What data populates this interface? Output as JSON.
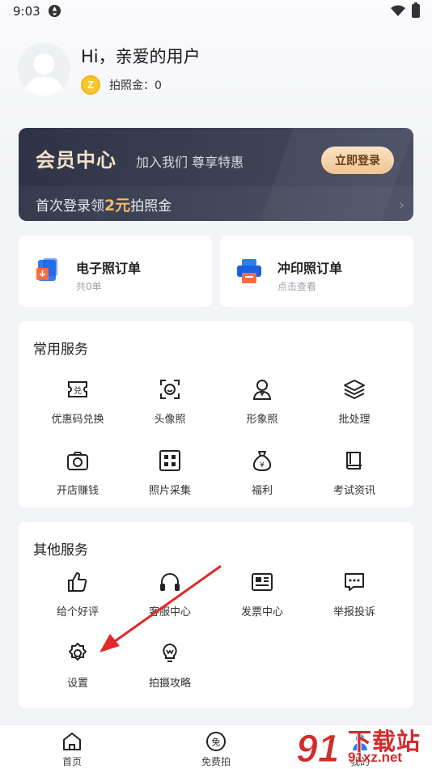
{
  "status_bar": {
    "time": "9:03"
  },
  "profile": {
    "greeting": "Hi，亲爱的用户",
    "coin_label": "拍照金：",
    "coin_value": "0",
    "coin_glyph": "Z"
  },
  "member": {
    "title": "会员中心",
    "subtitle": "加入我们  尊享特惠",
    "login_button": "立即登录",
    "promo_prefix": "首次登录领",
    "promo_amount": "2元",
    "promo_suffix": "拍照金"
  },
  "orders": [
    {
      "title": "电子照订单",
      "sub": "共0单",
      "icon": "e-photo-order-icon"
    },
    {
      "title": "冲印照订单",
      "sub": "点击查看",
      "icon": "print-order-icon"
    }
  ],
  "common_services": {
    "title": "常用服务",
    "items": [
      {
        "label": "优惠码兑换",
        "icon": "coupon-icon"
      },
      {
        "label": "头像照",
        "icon": "face-scan-icon"
      },
      {
        "label": "形象照",
        "icon": "portrait-icon"
      },
      {
        "label": "批处理",
        "icon": "layers-icon"
      },
      {
        "label": "开店赚钱",
        "icon": "camera-icon"
      },
      {
        "label": "照片采集",
        "icon": "grid-icon"
      },
      {
        "label": "福利",
        "icon": "money-bag-icon"
      },
      {
        "label": "考试资讯",
        "icon": "book-icon"
      }
    ]
  },
  "other_services": {
    "title": "其他服务",
    "items": [
      {
        "label": "给个好评",
        "icon": "thumbs-up-icon"
      },
      {
        "label": "客服中心",
        "icon": "headset-icon"
      },
      {
        "label": "发票中心",
        "icon": "invoice-icon"
      },
      {
        "label": "举报投诉",
        "icon": "report-icon"
      },
      {
        "label": "设置",
        "icon": "gear-icon"
      },
      {
        "label": "拍摄攻略",
        "icon": "lightbulb-icon"
      }
    ]
  },
  "bottom_nav": [
    {
      "label": "首页",
      "icon": "home-icon"
    },
    {
      "label": "免费拍",
      "icon": "free-shoot-icon",
      "glyph": "免"
    },
    {
      "label": "我的",
      "icon": "user-icon"
    }
  ],
  "watermark": {
    "text": "下载站",
    "url": "91xz.net",
    "logo_glyph": "91"
  },
  "colors": {
    "accent_gold": "#f0b96d",
    "banner_dark": "#2e3346",
    "coin_yellow": "#f7c631",
    "watermark_red": "#d42b2b"
  }
}
